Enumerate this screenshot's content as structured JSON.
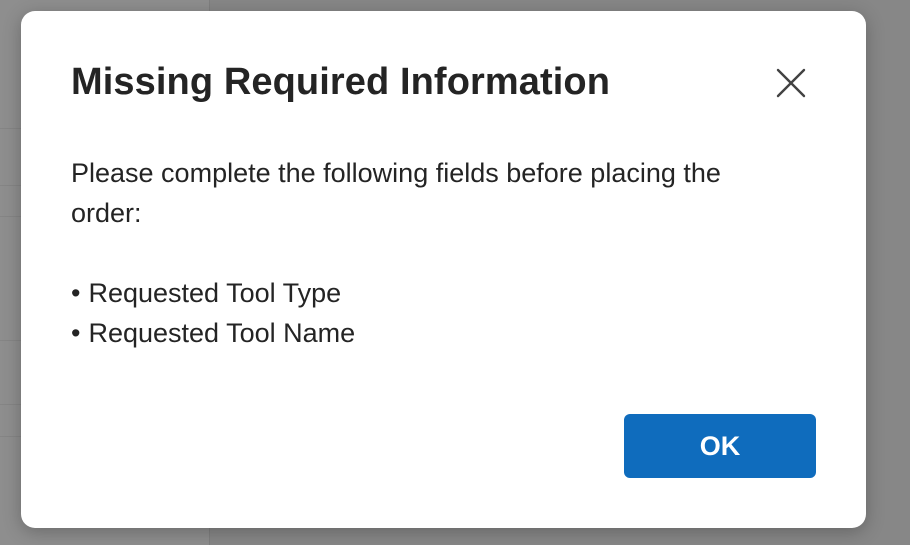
{
  "dialog": {
    "title": "Missing Required Information",
    "message": "Please complete the following fields before placing the order:",
    "missing_fields": [
      "Requested Tool Type",
      "Requested Tool Name"
    ],
    "bullet_glyph": "•",
    "ok_label": "OK",
    "close_icon": "close-icon"
  },
  "colors": {
    "accent": "#0f6cbd",
    "overlay": "#8a8a8a",
    "text": "#242424"
  }
}
